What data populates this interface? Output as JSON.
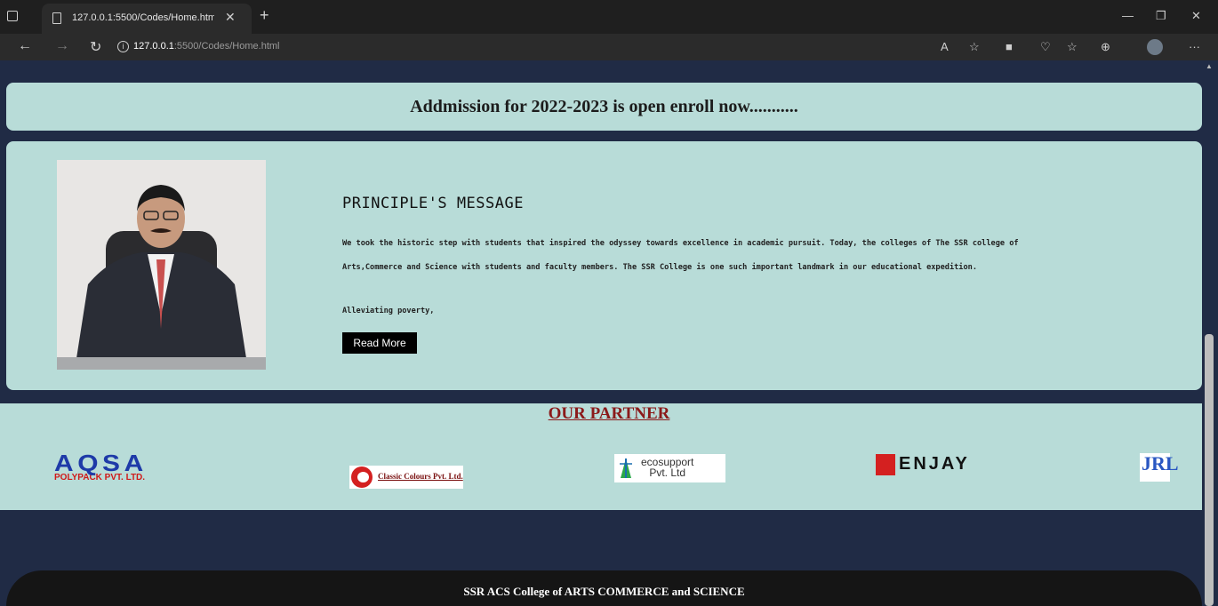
{
  "browser": {
    "tab_title": "127.0.0.1:5500/Codes/Home.htm",
    "url_host": "127.0.0.1",
    "url_path": ":5500/Codes/Home.html"
  },
  "banner": {
    "text": "Addmission for 2022-2023 is open enroll now..........."
  },
  "principal": {
    "title": "PRINCIPLE'S MESSAGE",
    "body": "We took the historic step with students that inspired the odyssey towards excellence in academic pursuit. Today, the colleges of The SSR college of Arts,Commerce and Science with students and faculty members. The SSR College is one such important landmark in our educational expedition.",
    "extra": "Alleviating poverty,",
    "button": "Read More"
  },
  "partners": {
    "title": "OUR PARTNER",
    "aqsa_main": "AQSA",
    "aqsa_sub": "POLYPACK PVT. LTD.",
    "classic": "Classic Colours Pvt. Ltd.",
    "eco_line1": "ecosupport",
    "eco_line2": "Pvt. Ltd",
    "enjay": "ENJAY",
    "jrl": "JRL"
  },
  "footer": {
    "text": "SSR ACS College of ARTS COMMERCE and SCIENCE"
  }
}
